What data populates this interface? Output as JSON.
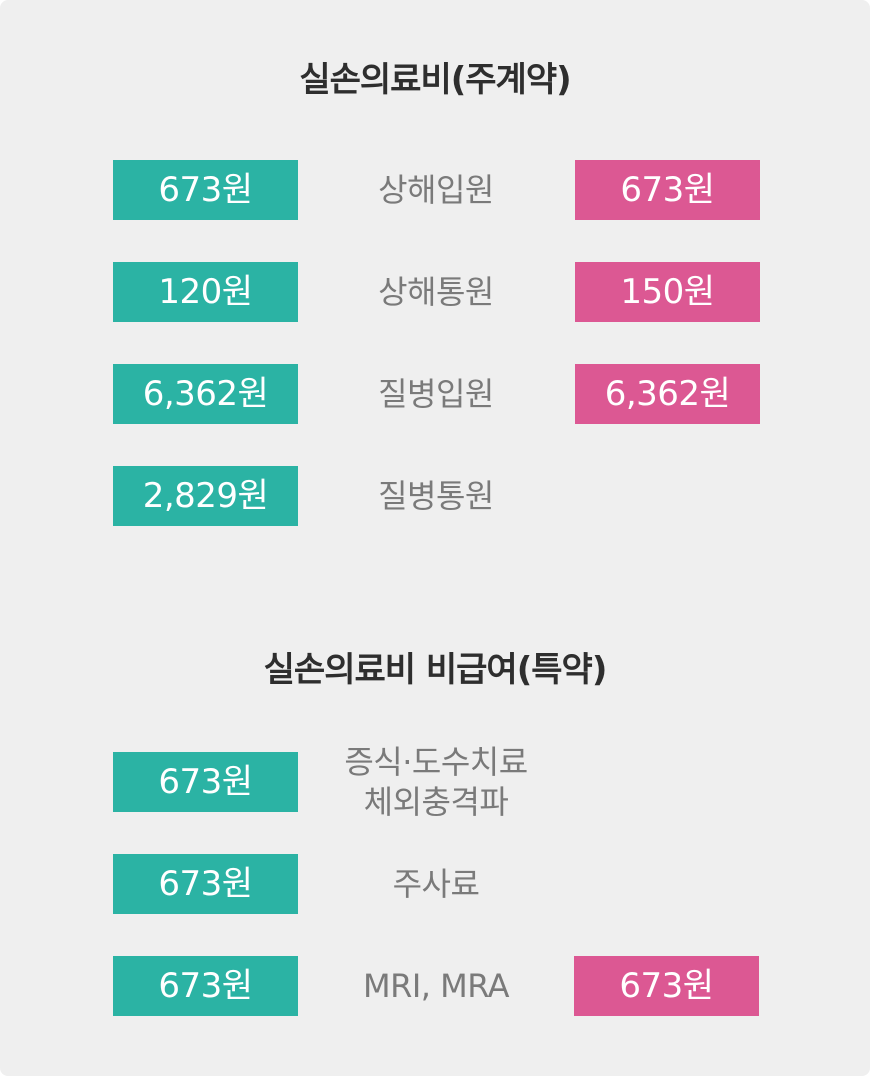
{
  "sections": [
    {
      "title": "실손의료비(주계약)",
      "rows": [
        {
          "left": "673원",
          "label": "상해입원",
          "right": "673원"
        },
        {
          "left": "120원",
          "label": "상해통원",
          "right": "150원"
        },
        {
          "left": "6,362원",
          "label": "질병입원",
          "right": "6,362원"
        },
        {
          "left": "2,829원",
          "label": "질병통원",
          "right": null
        }
      ]
    },
    {
      "title": "실손의료비 비급여(특약)",
      "rows": [
        {
          "left": "673원",
          "label_line1": "증식·도수치료",
          "label_line2": "체외충격파",
          "right": null
        },
        {
          "left": "673원",
          "label": "주사료",
          "right": null
        },
        {
          "left": "673원",
          "label": "MRI, MRA",
          "right": "673원"
        }
      ]
    }
  ],
  "colors": {
    "background": "#efefef",
    "left_pill": "#2bb3a4",
    "right_pill": "#dc5893",
    "label_text": "#7a7a7a",
    "title_text": "#2e2e2e"
  }
}
